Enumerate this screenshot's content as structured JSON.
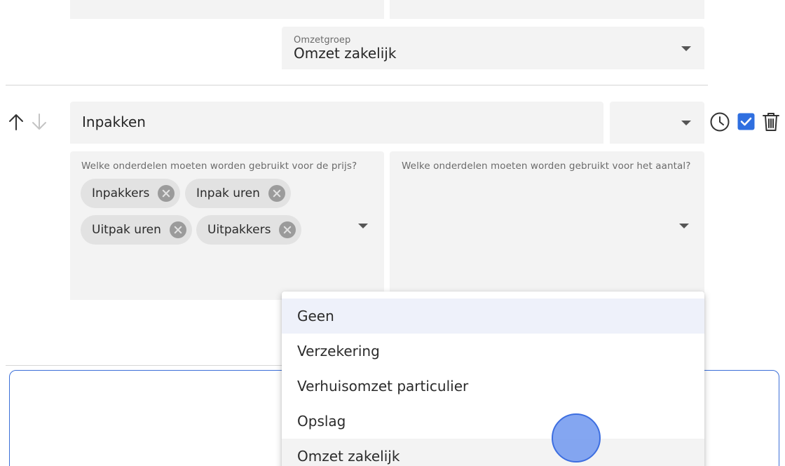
{
  "omzetgroep": {
    "label": "Omzetgroep",
    "value": "Omzet zakelijk"
  },
  "row": {
    "name": "Inpakken",
    "second_select_value": "",
    "checked": true
  },
  "price_parts": {
    "label": "Welke onderdelen moeten worden gebruikt voor de prijs?",
    "chips": [
      "Inpakkers",
      "Inpak uren",
      "Uitpak uren",
      "Uitpakkers"
    ]
  },
  "amount_parts": {
    "label": "Welke onderdelen moeten worden gebruikt voor het aantal?"
  },
  "dropdown": {
    "options": [
      "Geen",
      "Verzekering",
      "Verhuisomzet particulier",
      "Opslag",
      "Omzet zakelijk"
    ],
    "highlighted": "Geen",
    "selected": "Omzet zakelijk"
  },
  "icons": {
    "move_up": "arrow-up-icon",
    "move_down": "arrow-down-icon",
    "schedule": "clock-icon",
    "checkbox": "checkbox-icon",
    "delete": "trash-icon"
  },
  "colors": {
    "accent": "#2f6fe0",
    "field_bg": "#f3f3f3",
    "chip_bg": "#e2e2e2"
  }
}
